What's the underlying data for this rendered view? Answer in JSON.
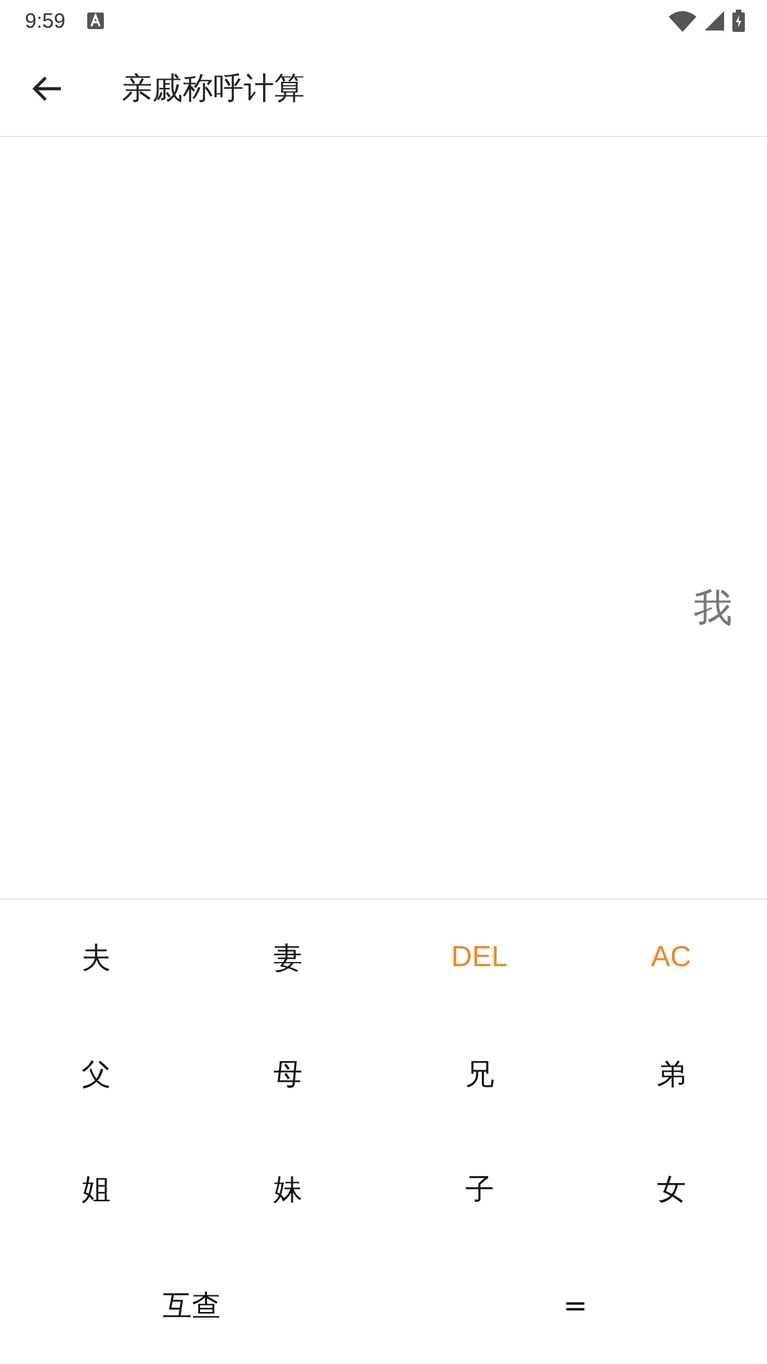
{
  "status_bar": {
    "time": "9:59"
  },
  "app_bar": {
    "title": "亲戚称呼计算"
  },
  "display": {
    "text": "我"
  },
  "keys": [
    {
      "label": "夫",
      "kind": "char"
    },
    {
      "label": "妻",
      "kind": "char"
    },
    {
      "label": "DEL",
      "kind": "action"
    },
    {
      "label": "AC",
      "kind": "action"
    },
    {
      "label": "父",
      "kind": "char"
    },
    {
      "label": "母",
      "kind": "char"
    },
    {
      "label": "兄",
      "kind": "char"
    },
    {
      "label": "弟",
      "kind": "char"
    },
    {
      "label": "姐",
      "kind": "char"
    },
    {
      "label": "妹",
      "kind": "char"
    },
    {
      "label": "子",
      "kind": "char"
    },
    {
      "label": "女",
      "kind": "char"
    },
    {
      "label": "互查",
      "kind": "wide"
    },
    {
      "label": "=",
      "kind": "wide"
    }
  ]
}
